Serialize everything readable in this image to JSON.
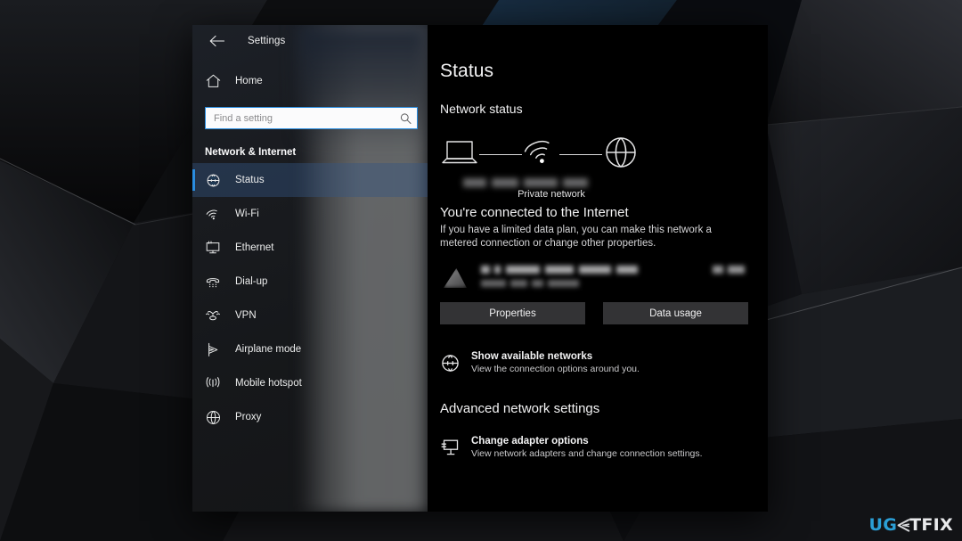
{
  "window": {
    "title": "Settings",
    "back_icon": "back-arrow-icon"
  },
  "sidebar": {
    "home": {
      "label": "Home",
      "icon": "home-icon"
    },
    "search": {
      "placeholder": "Find a setting",
      "value": "",
      "icon": "search-icon"
    },
    "section_heading": "Network & Internet",
    "items": [
      {
        "label": "Status",
        "icon": "network-status-icon",
        "selected": true
      },
      {
        "label": "Wi-Fi",
        "icon": "wifi-icon",
        "selected": false
      },
      {
        "label": "Ethernet",
        "icon": "ethernet-icon",
        "selected": false
      },
      {
        "label": "Dial-up",
        "icon": "dialup-phone-icon",
        "selected": false
      },
      {
        "label": "VPN",
        "icon": "vpn-icon",
        "selected": false
      },
      {
        "label": "Airplane mode",
        "icon": "airplane-icon",
        "selected": false
      },
      {
        "label": "Mobile hotspot",
        "icon": "hotspot-icon",
        "selected": false
      },
      {
        "label": "Proxy",
        "icon": "globe-icon",
        "selected": false
      }
    ]
  },
  "content": {
    "page_title": "Status",
    "network_status_heading": "Network status",
    "diagram": {
      "device_icon": "laptop-icon",
      "link_icon": "wifi-signal-icon",
      "internet_icon": "globe-icon",
      "ssid_label": "",
      "network_type": "Private network"
    },
    "connected_heading": "You're connected to the Internet",
    "connected_description": "If you have a limited data plan, you can make this network a metered connection or change other properties.",
    "connection_row": {
      "adapter_icon": "wifi-strength-icon",
      "name": "",
      "period": "",
      "usage": ""
    },
    "buttons": {
      "properties": "Properties",
      "data_usage": "Data usage"
    },
    "show_networks": {
      "icon": "globe-icon",
      "title": "Show available networks",
      "subtitle": "View the connection options around you."
    },
    "advanced_heading": "Advanced network settings",
    "change_adapter": {
      "icon": "adapter-monitor-icon",
      "title": "Change adapter options",
      "subtitle": "View network adapters and change connection settings."
    }
  },
  "watermark": {
    "prefix": "UG",
    "suffix": "TFIX",
    "mark_icon": "ugetfix-logo-mark"
  },
  "colors": {
    "accent": "#2a8de0",
    "window_bg": "#000000",
    "nav_bg": "#1c2027",
    "button_bg": "#333335",
    "watermark_blue": "#2b9fd6"
  }
}
